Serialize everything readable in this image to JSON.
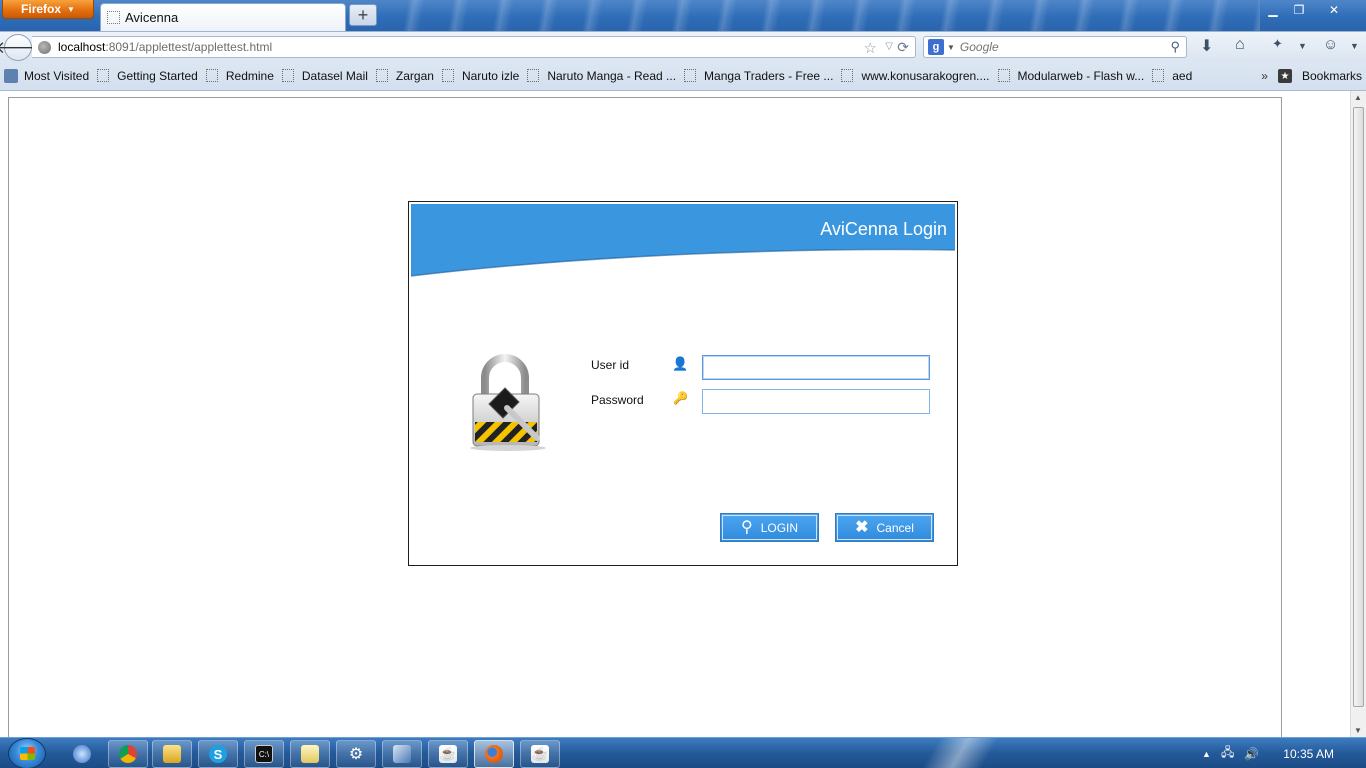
{
  "browser": {
    "menu_button": "Firefox",
    "tab_title": "Avicenna",
    "new_tab": "+",
    "url_host": "localhost",
    "url_path": ":8091/applettest/applettest.html",
    "search_placeholder": "Google",
    "window_controls": [
      "minimize",
      "restore",
      "close"
    ]
  },
  "bookmarks": {
    "items": [
      "Most Visited",
      "Getting Started",
      "Redmine",
      "Datasel Mail",
      "Zargan",
      "Naruto izle",
      "Naruto Manga - Read ...",
      "Manga Traders - Free ...",
      "www.konusarakogren....",
      "Modularweb - Flash w...",
      "aed"
    ],
    "overflow": "»",
    "menu_label": "Bookmarks"
  },
  "login": {
    "title": "AviCenna Login",
    "userid_label": "User id",
    "userid_value": "",
    "password_label": "Password",
    "password_value": "",
    "login_button": "LOGIN",
    "cancel_button": "Cancel",
    "colors": {
      "header": "#3b96e0",
      "button": "#3a9be9"
    }
  },
  "taskbar": {
    "apps": [
      "internet-explorer",
      "chrome",
      "explorer",
      "skype",
      "command-prompt",
      "notepad",
      "settings",
      "tool",
      "java",
      "firefox",
      "java"
    ],
    "clock": "10:35 AM"
  }
}
